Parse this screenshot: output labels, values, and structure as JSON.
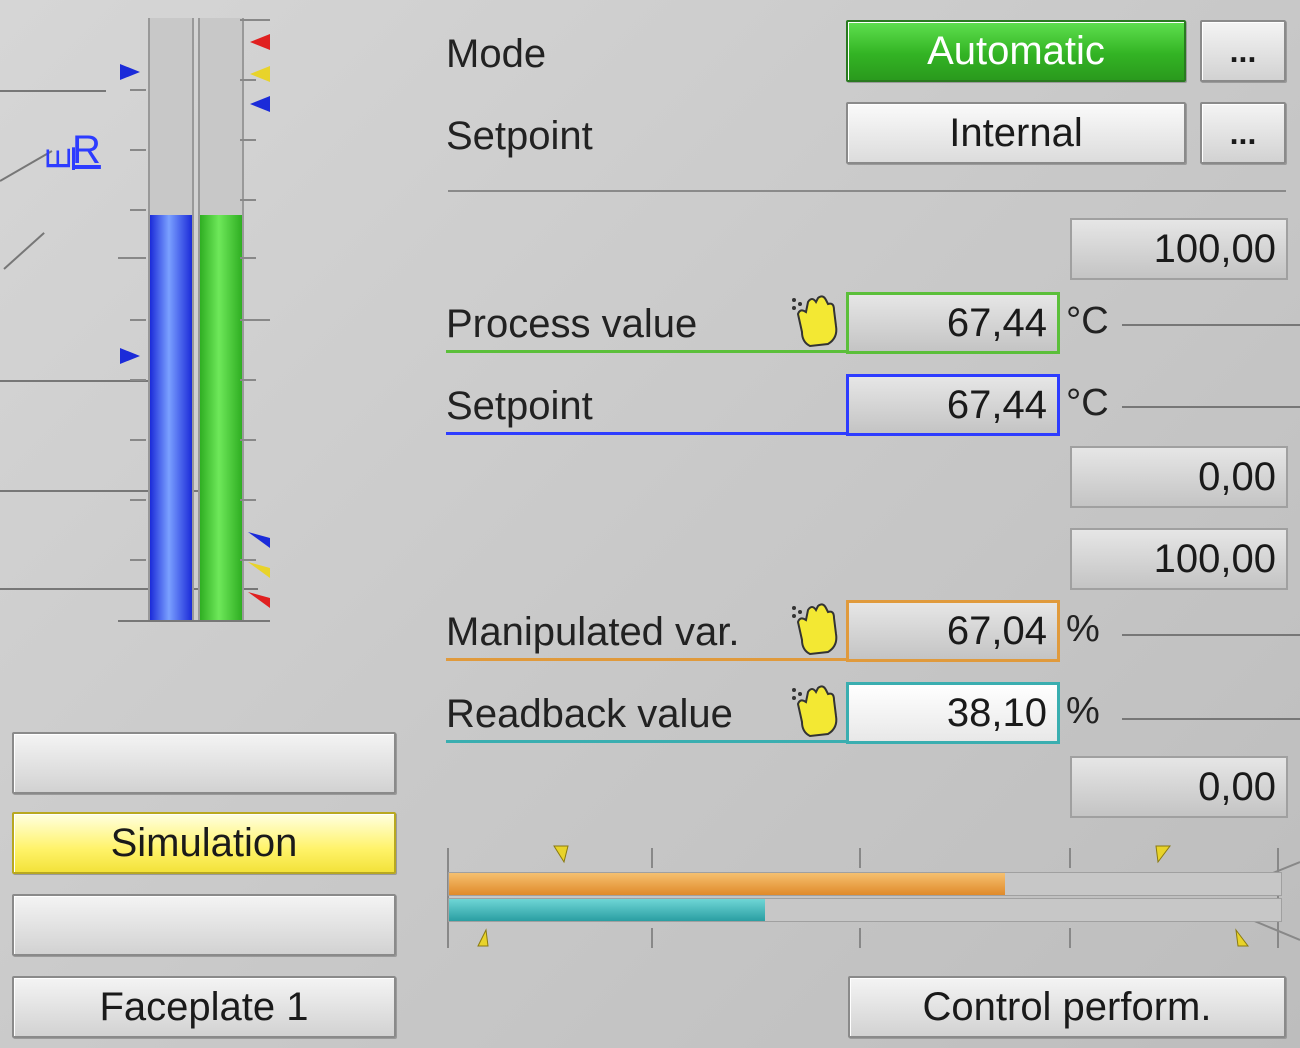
{
  "mode": {
    "label": "Mode",
    "value": "Automatic",
    "more": "..."
  },
  "setpoint_src": {
    "label": "Setpoint",
    "value": "Internal",
    "more": "..."
  },
  "pv_range": {
    "high": "100,00",
    "low": "0,00"
  },
  "process_value": {
    "label": "Process value",
    "value": "67,44",
    "unit": "°C"
  },
  "setpoint": {
    "label": "Setpoint",
    "value": "67,44",
    "unit": "°C"
  },
  "mv_range": {
    "high": "100,00",
    "low": "0,00"
  },
  "manipulated": {
    "label": "Manipulated var.",
    "value": "67,04",
    "unit": "%"
  },
  "readback": {
    "label": "Readback value",
    "value": "38,10",
    "unit": "%"
  },
  "left_buttons": {
    "simulation": "Simulation",
    "faceplate": "Faceplate 1"
  },
  "control_perform": "Control perform.",
  "bars": {
    "setpoint_fill": 0.6744,
    "pv_fill": 0.6744,
    "mv_fill": 0.6704,
    "rb_fill": 0.381
  },
  "mode_letters": {
    "r": "R",
    "e": "E"
  },
  "colors": {
    "pv": "#5bbf3a",
    "sp": "#2d3cff",
    "mv": "#e09a3c",
    "rb": "#3aaeb0",
    "auto": "#3fbf32"
  }
}
